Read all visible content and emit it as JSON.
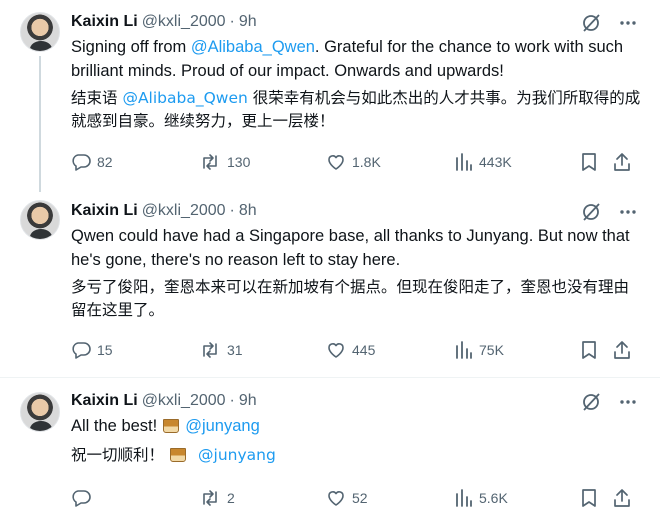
{
  "tweets": [
    {
      "author": {
        "name": "Kaixin Li",
        "handle": "@kxli_2000",
        "time": "9h"
      },
      "text_en": [
        {
          "t": "Signing off from ",
          "m": false
        },
        {
          "t": "@Alibaba_Qwen",
          "m": true
        },
        {
          "t": ". Grateful for the chance to work with such brilliant minds. Proud of our impact. Onwards and upwards!",
          "m": false
        }
      ],
      "text_zh": [
        {
          "t": "结束语 ",
          "m": false
        },
        {
          "t": "@Alibaba_Qwen",
          "m": true
        },
        {
          "t": " 很荣幸有机会与如此杰出的人才共事。为我们所取得的成就感到自豪。继续努力，更上一层楼！",
          "m": false
        }
      ],
      "stats": {
        "replies": "82",
        "reposts": "130",
        "likes": "1.8K",
        "views": "443K"
      }
    },
    {
      "author": {
        "name": "Kaixin Li",
        "handle": "@kxli_2000",
        "time": "8h"
      },
      "text_en": [
        {
          "t": "Qwen could have had a Singapore base, all thanks to Junyang. But now that he's gone, there's no reason left to stay here.",
          "m": false
        }
      ],
      "text_zh": [
        {
          "t": "多亏了俊阳，奎恩本来可以在新加坡有个据点。但现在俊阳走了，奎恩也没有理由留在这里了。",
          "m": false
        }
      ],
      "stats": {
        "replies": "15",
        "reposts": "31",
        "likes": "445",
        "views": "75K"
      }
    },
    {
      "author": {
        "name": "Kaixin Li",
        "handle": "@kxli_2000",
        "time": "9h"
      },
      "text_en_prefix": "All the best!",
      "text_en_mention": "@junyang",
      "text_zh_prefix": "祝一切顺利！",
      "text_zh_mention": "@junyang",
      "emoji": "tumbler-glass",
      "stats": {
        "replies": "",
        "reposts": "2",
        "likes": "52",
        "views": "5.6K"
      }
    }
  ],
  "icons": {
    "grok": "grok-slash-icon",
    "more": "more-dots-icon",
    "reply": "reply-icon",
    "repost": "repost-icon",
    "like": "heart-icon",
    "views": "views-bars-icon",
    "bookmark": "bookmark-icon",
    "share": "share-icon"
  },
  "colors": {
    "text": "#0f1419",
    "secondary": "#536471",
    "link": "#1d9bf0",
    "divider": "#eff3f4",
    "thread": "#cfd9de"
  }
}
